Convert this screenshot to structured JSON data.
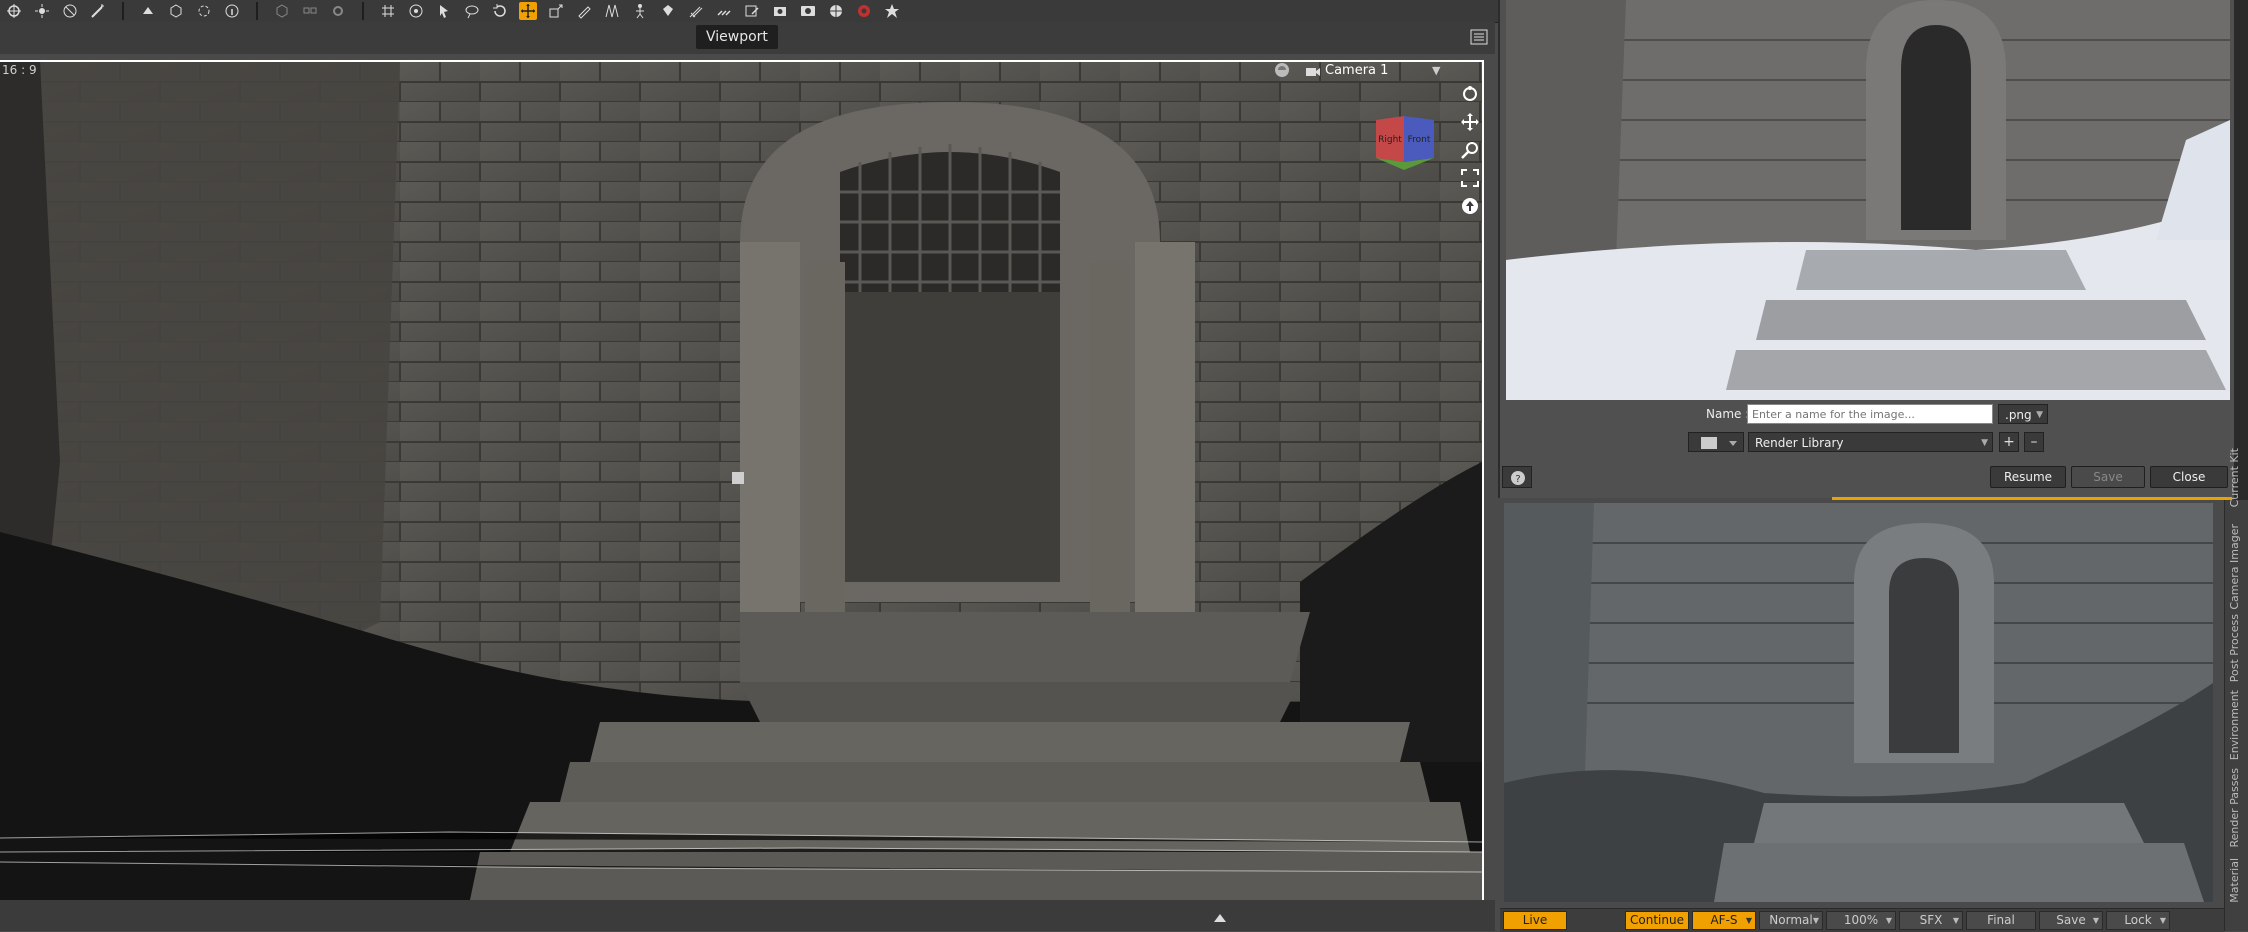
{
  "viewport": {
    "tab_label": "Viewport",
    "aspect_ratio": "16 : 9",
    "camera_name": "Camera 1",
    "view_cube_left": "Right",
    "view_cube_right": "Front"
  },
  "render_window": {
    "name_label": "Name :",
    "name_placeholder": "Enter a name for the image...",
    "extension": ".png",
    "library": "Render Library",
    "plus_label": "+",
    "minus_label": "–",
    "resume_label": "Resume",
    "save_label": "Save",
    "close_label": "Close"
  },
  "side_tabs": [
    "Material",
    "Render Passes",
    "Environment",
    "Post Process",
    "Camera Imager",
    "Current Kit"
  ],
  "bottom_bar": {
    "live": "Live",
    "continue": "Continue",
    "afs": "AF-S",
    "normal": "Normal",
    "zoom": "100%",
    "sfx": "SFX",
    "final": "Final",
    "save": "Save",
    "lock": "Lock"
  },
  "colors": {
    "accent": "#f0a000",
    "panel": "#3a3a3a",
    "viewport_border": "#ffffff"
  }
}
